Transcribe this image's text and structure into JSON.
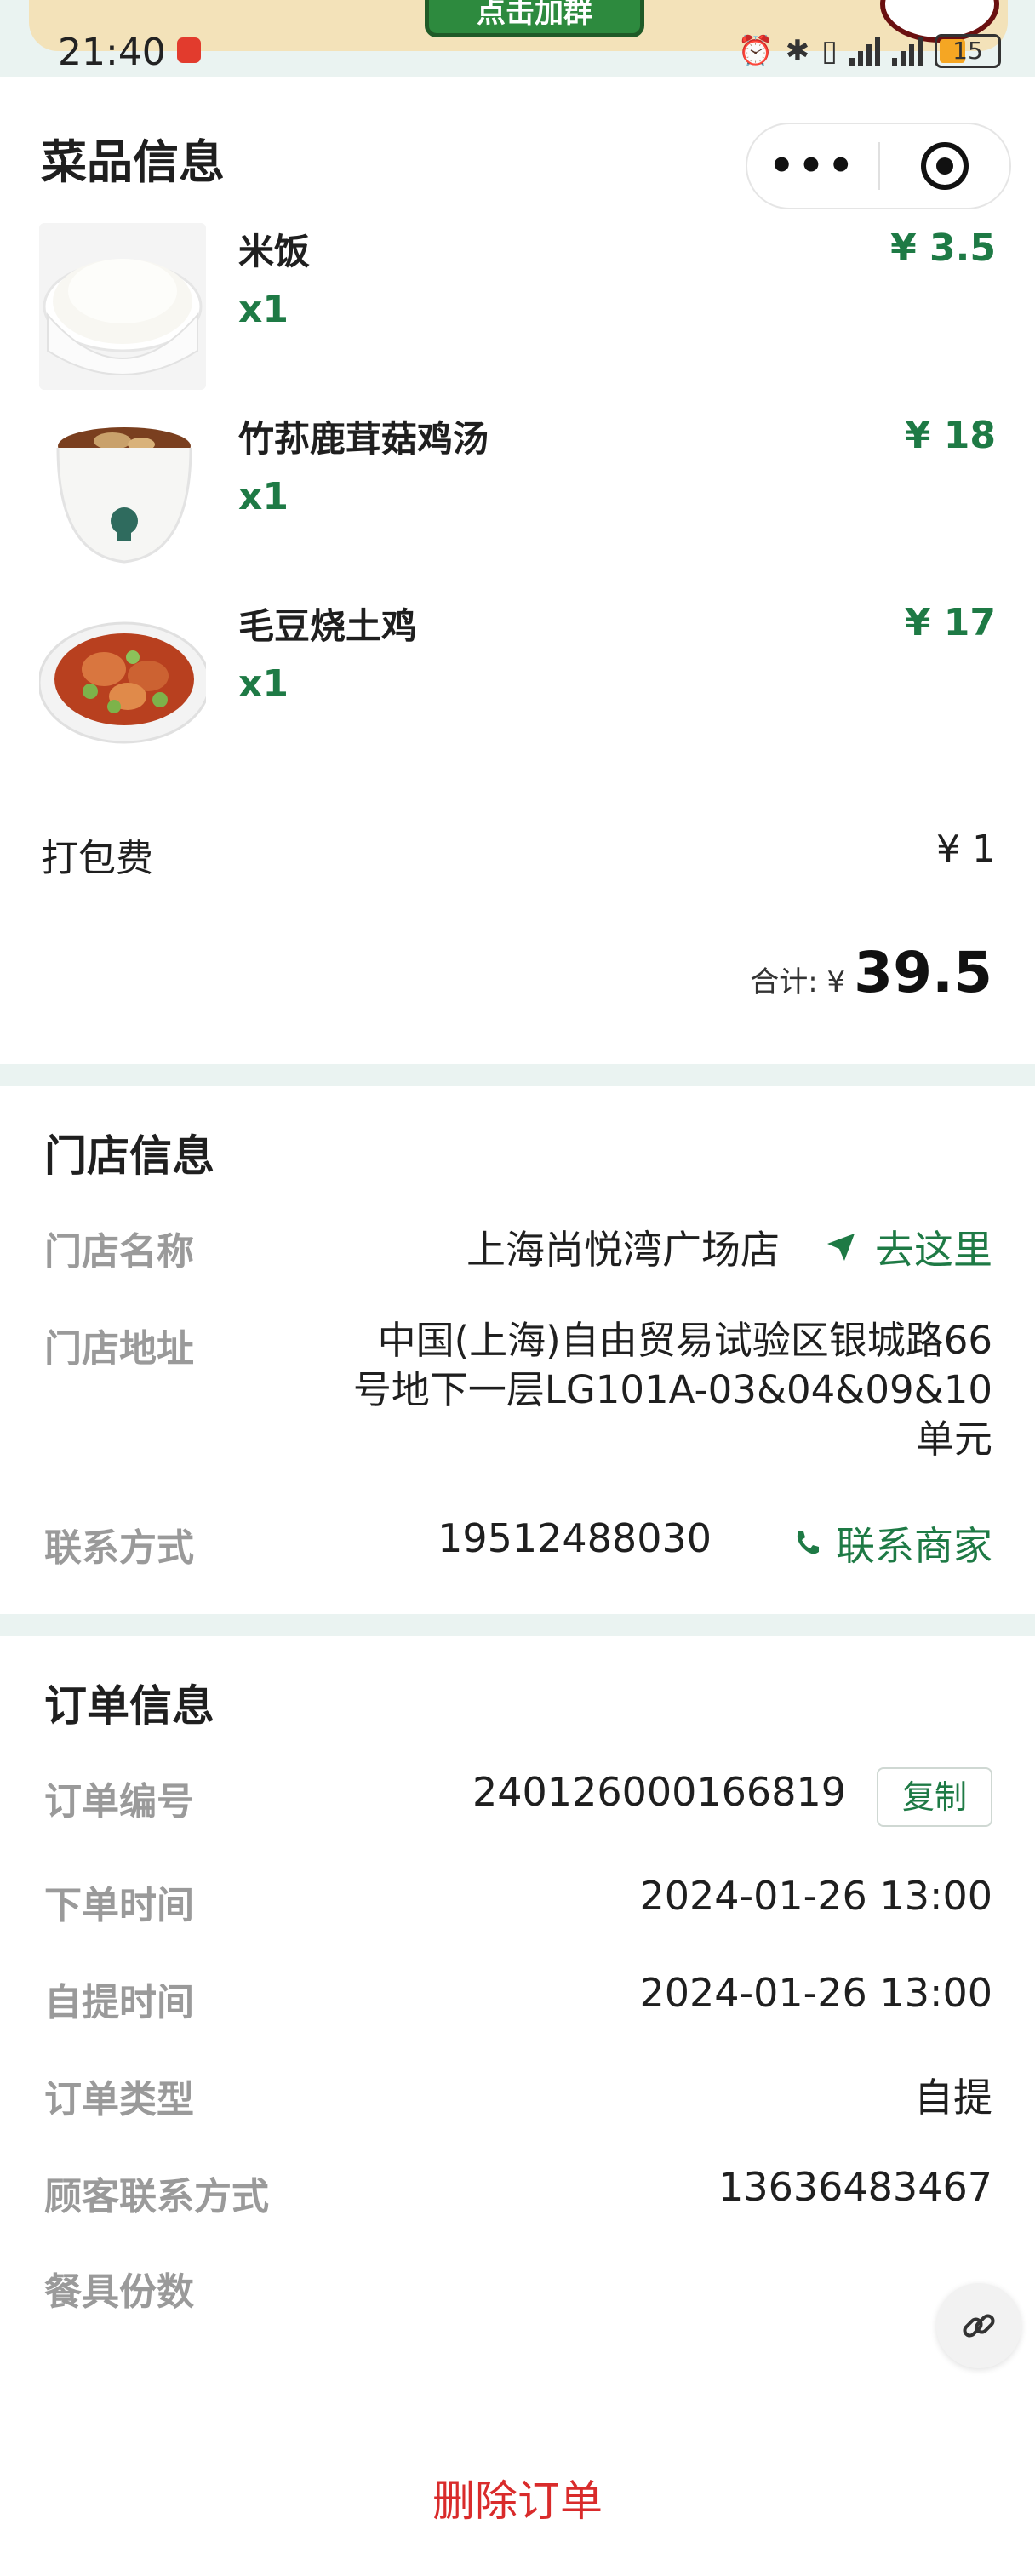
{
  "status_bar": {
    "time": "21:40",
    "battery": "15",
    "banner_button": "点击加群"
  },
  "capsule": {
    "more_icon": "ellipsis-icon",
    "close_icon": "target-icon"
  },
  "dishes_section": {
    "title": "菜品信息",
    "items": [
      {
        "name": "米饭",
        "qty": "x1",
        "price": "¥ 3.5"
      },
      {
        "name": "竹荪鹿茸菇鸡汤",
        "qty": "x1",
        "price": "¥ 18"
      },
      {
        "name": "毛豆烧土鸡",
        "qty": "x1",
        "price": "¥ 17"
      }
    ],
    "packing_fee_label": "打包费",
    "packing_fee_value": "¥ 1",
    "total_label": "合计: ¥",
    "total_value": "39.5"
  },
  "store_section": {
    "title": "门店信息",
    "name_label": "门店名称",
    "name_value": "上海尚悦湾广场店",
    "navigate_label": "去这里",
    "address_label": "门店地址",
    "address_lines": [
      "中国(上海)自由贸易试验区银城路66",
      "号地下一层LG101A-03&04&09&10",
      "单元"
    ],
    "contact_label": "联系方式",
    "contact_value": "19512488030",
    "call_label": "联系商家"
  },
  "order_section": {
    "title": "订单信息",
    "number_label": "订单编号",
    "number_value": "240126000166819",
    "copy_label": "复制",
    "order_time_label": "下单时间",
    "order_time_value": "2024-01-26 13:00",
    "pickup_time_label": "自提时间",
    "pickup_time_value": "2024-01-26 13:00",
    "type_label": "订单类型",
    "type_value": "自提",
    "customer_contact_label": "顾客联系方式",
    "customer_contact_value": "13636483467",
    "utensils_label": "餐具份数"
  },
  "footer": {
    "delete_label": "删除订单"
  },
  "colors": {
    "accent_green": "#1e7a45",
    "separator": "#eaf3f1",
    "danger": "#d92b2b",
    "label_gray": "#9a9a9a"
  }
}
